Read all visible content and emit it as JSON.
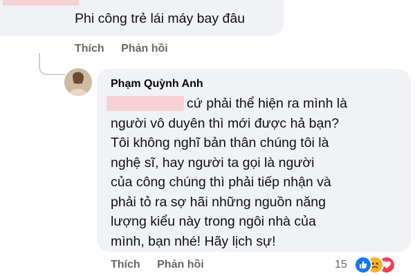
{
  "parent_comment": {
    "text": "Phi công trẻ lái máy bay đâu",
    "like_label": "Thích",
    "reply_label": "Phản hồi"
  },
  "reply_comment": {
    "author": "Phạm Quỳnh Anh",
    "lines": [
      "cứ phải thể hiện ra mình là",
      "người vô duyên thì mới được hả bạn?",
      "Tôi không nghĩ bản thân chúng tôi là",
      "nghệ sĩ, hay người ta gọi là người",
      "của công chúng thì phải tiếp nhận và",
      "phải tỏ ra sợ hãi những nguồn năng",
      "lượng kiểu này trong ngôi nhà của",
      "mình, bạn nhé! Hãy lịch sự!"
    ],
    "like_label": "Thích",
    "reply_label": "Phản hồi",
    "reaction_count": "15",
    "reactions": [
      "like-icon",
      "sad-icon",
      "love-icon"
    ]
  },
  "colors": {
    "bubble": "#f0f2f5",
    "action_text": "#65676b",
    "redaction": "#f6d2d2",
    "like": "#1877f2",
    "sad": "#f7b125",
    "love": "#f33e58"
  }
}
